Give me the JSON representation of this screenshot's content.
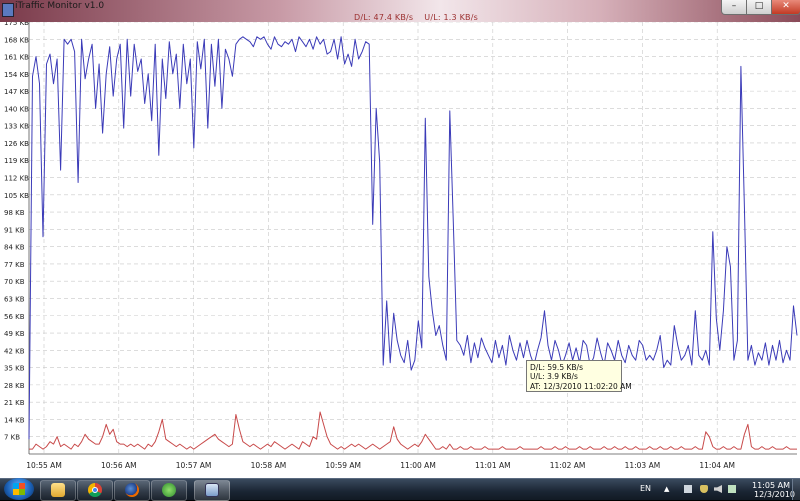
{
  "window": {
    "title": "iTraffic Monitor v1.0",
    "status": "D/L: 47.4 KB/s    U/L: 1.3 KB/s",
    "min_label": "–",
    "max_label": "□",
    "close_label": "✕"
  },
  "chart_data": {
    "type": "line",
    "ylim": [
      0,
      175
    ],
    "yticks": [
      "175 KB",
      "168 KB",
      "161 KB",
      "154 KB",
      "147 KB",
      "140 KB",
      "133 KB",
      "126 KB",
      "119 KB",
      "112 KB",
      "105 KB",
      "98 KB",
      "91 KB",
      "84 KB",
      "77 KB",
      "70 KB",
      "63 KB",
      "56 KB",
      "49 KB",
      "42 KB",
      "35 KB",
      "28 KB",
      "21 KB",
      "14 KB",
      "7 KB"
    ],
    "xticks": [
      "10:55 AM",
      "10:56 AM",
      "10:57 AM",
      "10:58 AM",
      "10:59 AM",
      "11:00 AM",
      "11:01 AM",
      "11:02 AM",
      "11:03 AM",
      "11:04 AM"
    ],
    "grid": true,
    "series": [
      {
        "color": "#3b3bb8",
        "values": [
          6,
          153,
          161,
          150,
          88,
          158,
          162,
          150,
          160,
          115,
          168,
          166,
          168,
          163,
          110,
          168,
          152,
          160,
          166,
          140,
          158,
          130,
          154,
          165,
          145,
          160,
          166,
          132,
          168,
          145,
          166,
          155,
          160,
          142,
          154,
          135,
          166,
          121,
          160,
          144,
          167,
          154,
          162,
          140,
          166,
          150,
          160,
          124,
          167,
          156,
          168,
          132,
          166,
          149,
          168,
          140,
          164,
          160,
          153,
          166,
          168,
          169,
          168,
          167,
          165,
          169,
          168,
          169,
          166,
          164,
          169,
          166,
          165,
          167,
          166,
          168,
          163,
          169,
          167,
          165,
          168,
          164,
          169,
          166,
          168,
          162,
          163,
          168,
          160,
          169,
          158,
          162,
          157,
          168,
          160,
          163,
          167,
          166,
          93,
          140,
          118,
          36,
          62,
          37,
          57,
          46,
          40,
          37,
          46,
          34,
          38,
          54,
          43,
          136,
          72,
          58,
          48,
          52,
          44,
          38,
          139,
          94,
          46,
          44,
          40,
          48,
          37,
          45,
          39,
          47,
          43,
          40,
          37,
          46,
          39,
          44,
          36,
          48,
          42,
          38,
          45,
          39,
          46,
          40,
          36,
          42,
          47,
          58,
          44,
          38,
          46,
          42,
          36,
          40,
          45,
          38,
          43,
          37,
          46,
          44,
          36,
          39,
          47,
          41,
          36,
          45,
          42,
          38,
          46,
          40,
          37,
          44,
          40,
          38,
          46,
          44,
          38,
          40,
          38,
          42,
          48,
          35,
          38,
          36,
          52,
          44,
          38,
          40,
          44,
          36,
          58,
          40,
          38,
          42,
          36,
          90,
          55,
          42,
          58,
          84,
          76,
          38,
          46,
          157,
          100,
          38,
          44,
          36,
          41,
          38,
          45,
          36,
          44,
          38,
          46,
          37,
          42,
          38,
          60,
          48
        ],
        "name": ""
      },
      {
        "color": "#c84a4a",
        "values": [
          2,
          2,
          4,
          3,
          2,
          3,
          5,
          4,
          7,
          3,
          4,
          3,
          2,
          4,
          3,
          5,
          8,
          6,
          5,
          4,
          4,
          7,
          12,
          8,
          10,
          5,
          4,
          4,
          3,
          4,
          3,
          4,
          3,
          2,
          4,
          3,
          5,
          9,
          14,
          6,
          5,
          4,
          3,
          4,
          3,
          2,
          3,
          2,
          3,
          4,
          5,
          6,
          7,
          8,
          6,
          5,
          4,
          3,
          4,
          16,
          10,
          5,
          4,
          3,
          4,
          3,
          2,
          3,
          4,
          3,
          5,
          4,
          3,
          2,
          3,
          4,
          3,
          2,
          5,
          4,
          3,
          7,
          6,
          17,
          12,
          7,
          4,
          3,
          2,
          3,
          2,
          3,
          4,
          3,
          4,
          3,
          2,
          3,
          4,
          3,
          2,
          3,
          4,
          5,
          11,
          6,
          4,
          3,
          2,
          3,
          4,
          3,
          5,
          8,
          6,
          4,
          2,
          2,
          3,
          2,
          4,
          2,
          2,
          3,
          2,
          2,
          3,
          2,
          2,
          2,
          3,
          2,
          2,
          2,
          2,
          3,
          2,
          2,
          2,
          2,
          3,
          2,
          2,
          2,
          2,
          2,
          3,
          2,
          2,
          2,
          3,
          2,
          2,
          3,
          2,
          2,
          2,
          3,
          2,
          2,
          3,
          2,
          2,
          2,
          3,
          2,
          2,
          3,
          2,
          2,
          3,
          2,
          2,
          3,
          2,
          2,
          2,
          3,
          2,
          2,
          3,
          2,
          2,
          3,
          2,
          2,
          3,
          2,
          2,
          2,
          3,
          2,
          2,
          9,
          7,
          3,
          2,
          2,
          3,
          2,
          2,
          3,
          2,
          2,
          8,
          12,
          3,
          2,
          2,
          3,
          2,
          2,
          3,
          2,
          2,
          2,
          3,
          2,
          2,
          2
        ],
        "name": ""
      }
    ]
  },
  "tooltip": {
    "dl": "D/L: 59.5 KB/s",
    "ul": "U/L: 3.9 KB/s",
    "at": "AT:  12/3/2010 11:02:20 AM"
  },
  "taskbar": {
    "lang": "EN",
    "time": "11:05 AM",
    "date": "12/3/2010",
    "tray_chevron": "▲"
  }
}
